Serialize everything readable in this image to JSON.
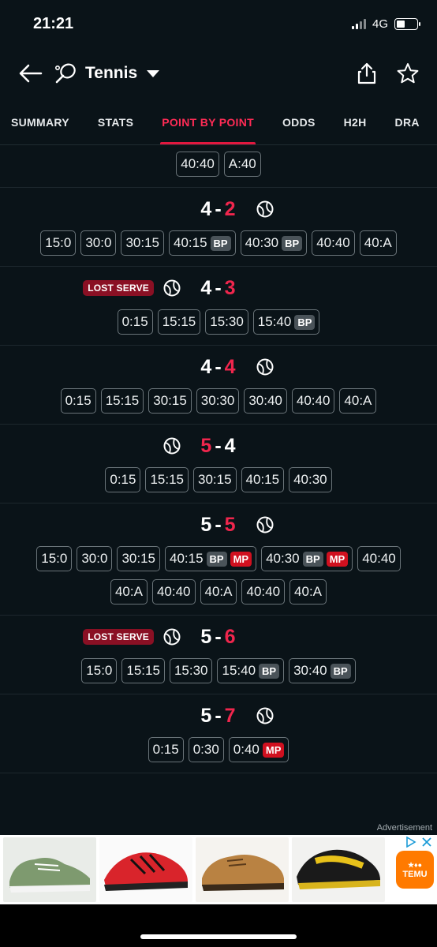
{
  "status": {
    "time": "21:21",
    "network": "4G"
  },
  "header": {
    "title": "Tennis"
  },
  "tabs": [
    "SUMMARY",
    "STATS",
    "POINT BY POINT",
    "ODDS",
    "H2H",
    "DRA"
  ],
  "games": [
    {
      "score": null,
      "rows": [
        [
          {
            "t": "40:40"
          },
          {
            "t": "A:40"
          }
        ]
      ]
    },
    {
      "score": {
        "home": "4",
        "away": "2",
        "red": "away"
      },
      "serve": "right",
      "lost": null,
      "rows": [
        [
          {
            "t": "15:0"
          },
          {
            "t": "30:0"
          },
          {
            "t": "30:15"
          },
          {
            "t": "40:15",
            "tags": [
              "BP"
            ]
          },
          {
            "t": "40:30",
            "tags": [
              "BP"
            ]
          },
          {
            "t": "40:40"
          },
          {
            "t": "40:A"
          }
        ]
      ]
    },
    {
      "score": {
        "home": "4",
        "away": "3",
        "red": "away"
      },
      "serve": "left",
      "lost": "LOST SERVE",
      "rows": [
        [
          {
            "t": "0:15"
          },
          {
            "t": "15:15"
          },
          {
            "t": "15:30"
          },
          {
            "t": "15:40",
            "tags": [
              "BP"
            ]
          }
        ]
      ]
    },
    {
      "score": {
        "home": "4",
        "away": "4",
        "red": "away"
      },
      "serve": "right",
      "lost": null,
      "rows": [
        [
          {
            "t": "0:15"
          },
          {
            "t": "15:15"
          },
          {
            "t": "30:15"
          },
          {
            "t": "30:30"
          },
          {
            "t": "30:40"
          },
          {
            "t": "40:40"
          },
          {
            "t": "40:A"
          }
        ]
      ]
    },
    {
      "score": {
        "home": "5",
        "away": "4",
        "red": "home"
      },
      "serve": "left",
      "lost": null,
      "rows": [
        [
          {
            "t": "0:15"
          },
          {
            "t": "15:15"
          },
          {
            "t": "30:15"
          },
          {
            "t": "40:15"
          },
          {
            "t": "40:30"
          }
        ]
      ]
    },
    {
      "score": {
        "home": "5",
        "away": "5",
        "red": "away"
      },
      "serve": "right",
      "lost": null,
      "rows": [
        [
          {
            "t": "15:0"
          },
          {
            "t": "30:0"
          },
          {
            "t": "30:15"
          },
          {
            "t": "40:15",
            "tags": [
              "BP",
              "MP"
            ]
          },
          {
            "t": "40:30",
            "tags": [
              "BP",
              "MP"
            ]
          },
          {
            "t": "40:40"
          }
        ],
        [
          {
            "t": "40:A"
          },
          {
            "t": "40:40"
          },
          {
            "t": "40:A"
          },
          {
            "t": "40:40"
          },
          {
            "t": "40:A"
          }
        ]
      ]
    },
    {
      "score": {
        "home": "5",
        "away": "6",
        "red": "away"
      },
      "serve": "left",
      "lost": "LOST SERVE",
      "rows": [
        [
          {
            "t": "15:0"
          },
          {
            "t": "15:15"
          },
          {
            "t": "15:30"
          },
          {
            "t": "15:40",
            "tags": [
              "BP"
            ]
          },
          {
            "t": "30:40",
            "tags": [
              "BP"
            ]
          }
        ]
      ]
    },
    {
      "score": {
        "home": "5",
        "away": "7",
        "red": "away"
      },
      "serve": "right",
      "lost": null,
      "rows": [
        [
          {
            "t": "0:15"
          },
          {
            "t": "0:30"
          },
          {
            "t": "0:40",
            "tags": [
              "MP"
            ]
          }
        ]
      ]
    }
  ],
  "ad": {
    "label": "Advertisement",
    "brand": "TEMU"
  },
  "colors": {
    "accent": "#e2183f",
    "background": "#0a1318",
    "bp": "#4a5359",
    "mp": "#d0101f"
  }
}
